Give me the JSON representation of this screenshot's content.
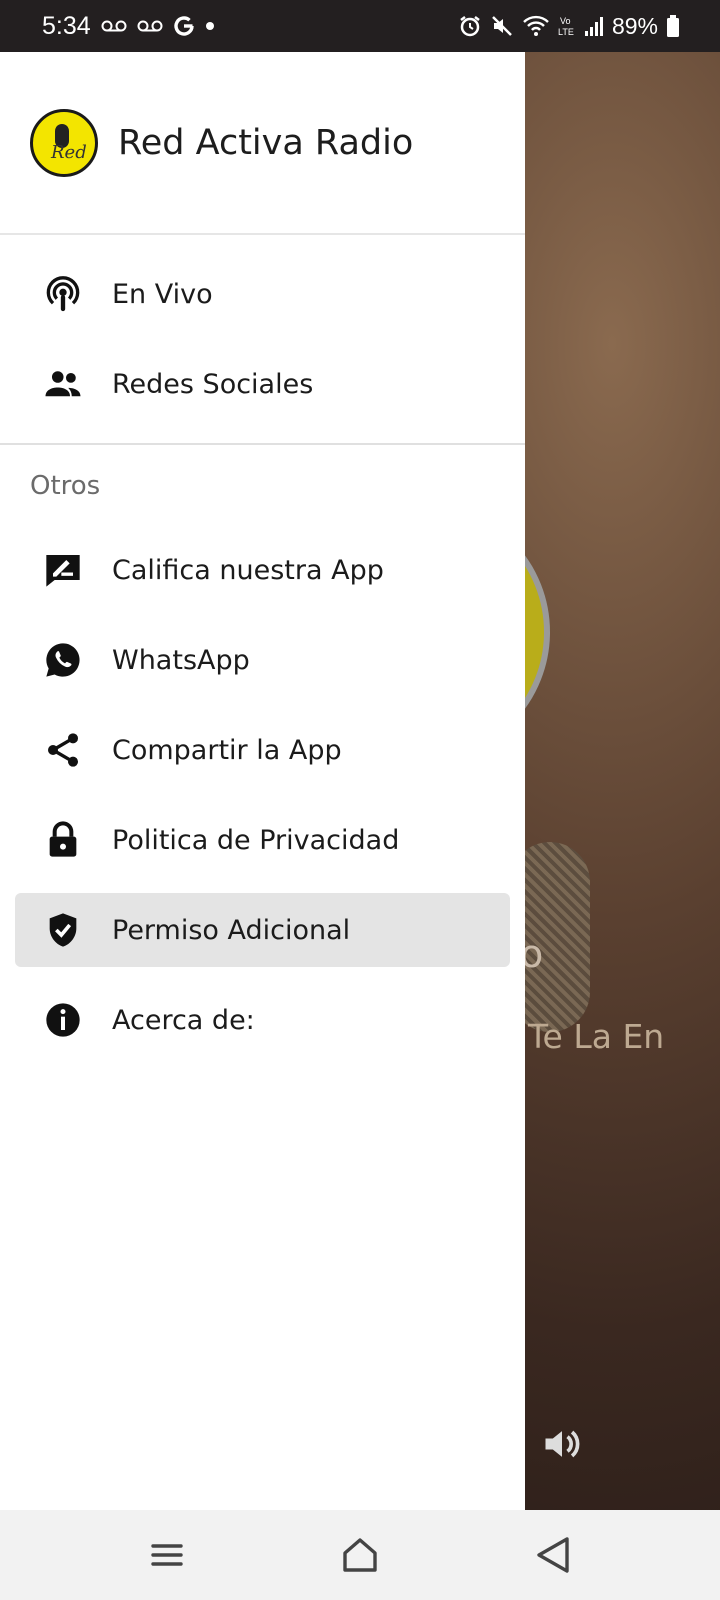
{
  "status_bar": {
    "time": "5:34",
    "battery": "89%",
    "left_icons": [
      "voicemail-icon",
      "voicemail-icon",
      "google-icon",
      "dot-icon"
    ],
    "right_icons": [
      "alarm-icon",
      "mute-icon",
      "wifi-icon",
      "volte-icon",
      "signal-icon",
      "battery-icon"
    ]
  },
  "drawer": {
    "app_name": "Red Activa Radio",
    "main_items": [
      {
        "label": "En Vivo",
        "icon": "podcast-icon"
      },
      {
        "label": "Redes Sociales",
        "icon": "people-icon"
      }
    ],
    "section_label": "Otros",
    "other_items": [
      {
        "label": "Califica nuestra App",
        "icon": "rate-review-icon"
      },
      {
        "label": "WhatsApp",
        "icon": "whatsapp-icon"
      },
      {
        "label": "Compartir la App",
        "icon": "share-icon"
      },
      {
        "label": "Politica de Privacidad",
        "icon": "lock-icon"
      },
      {
        "label": "Permiso Adicional",
        "icon": "shield-check-icon",
        "selected": true
      },
      {
        "label": "Acerca de:",
        "icon": "info-icon"
      }
    ]
  },
  "background": {
    "title_fragment": "o",
    "subtitle_fragment": "Te La En"
  },
  "nav_bar": {
    "buttons": [
      "recents-icon",
      "home-icon",
      "back-icon"
    ]
  }
}
